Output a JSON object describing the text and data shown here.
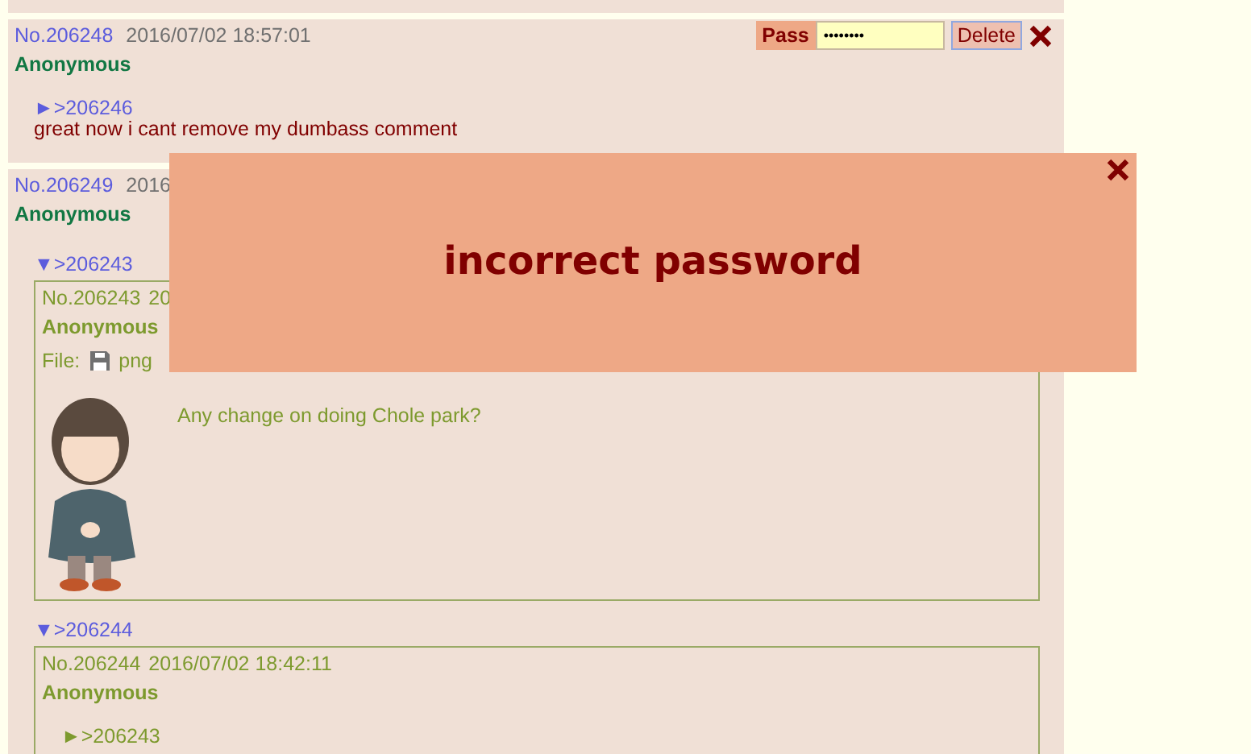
{
  "posts": [
    {
      "number": "No.206248",
      "date": "2016/07/02 18:57:01",
      "name": "Anonymous",
      "delete_form": {
        "label": "Pass",
        "password": "••••••••",
        "button": "Delete"
      },
      "quote": "►>206246",
      "comment": "great now i cant remove my dumbass comment"
    },
    {
      "number": "No.206249",
      "date": "2016",
      "name": "Anonymous",
      "replies": [
        {
          "link": "▼>206243",
          "post": {
            "number": "No.206243",
            "date": "20",
            "name": "Anonymous",
            "file_label": "File:",
            "file_type": "png",
            "comment": "Any change on doing Chole park?"
          }
        },
        {
          "link": "▼>206244",
          "post": {
            "number": "No.206244",
            "date": "2016/07/02 18:42:11",
            "name": "Anonymous",
            "quote": "►>206243"
          }
        }
      ]
    }
  ],
  "modal": {
    "message": "incorrect password"
  }
}
